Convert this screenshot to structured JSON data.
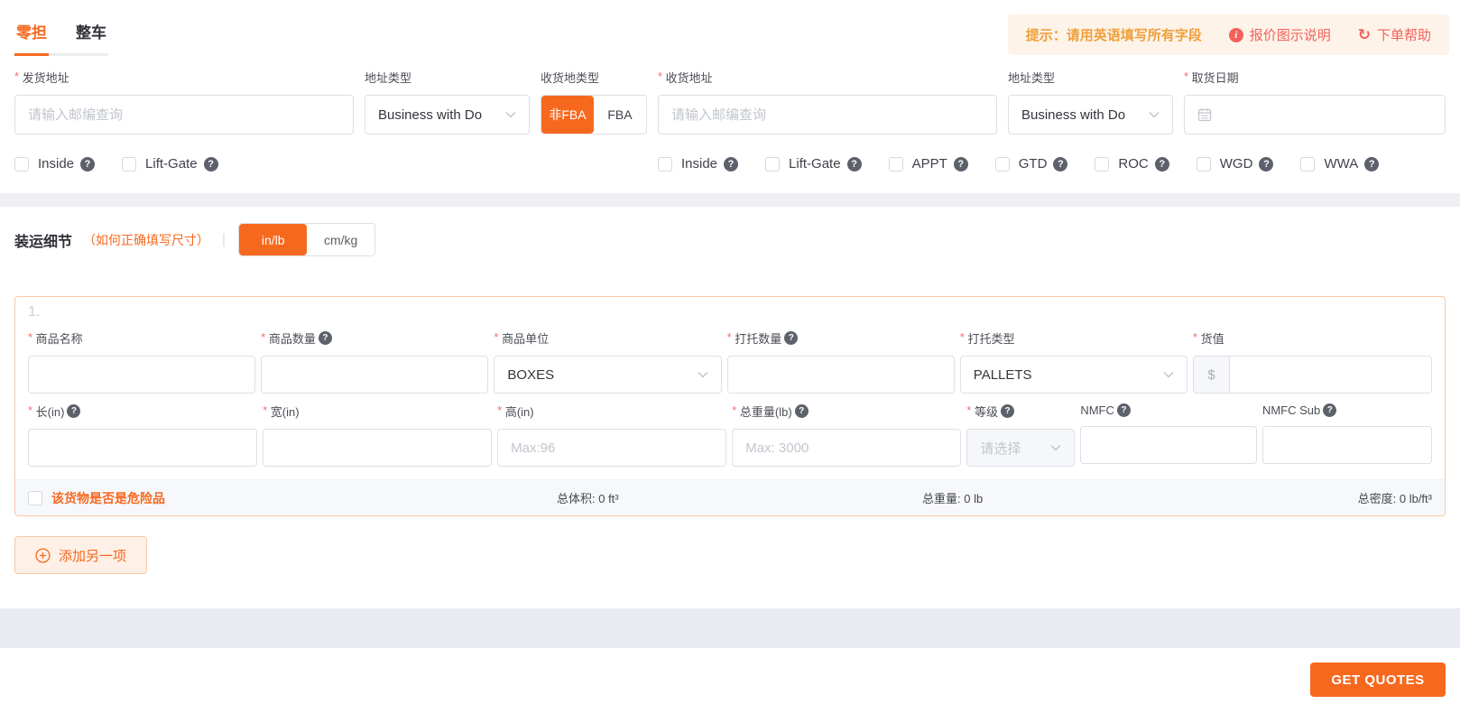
{
  "tabs": [
    {
      "label": "零担",
      "active": true
    },
    {
      "label": "整车",
      "active": false
    }
  ],
  "hint_bar": {
    "tip": "提示：请用英语填写所有字段",
    "quote_guide": "报价图示说明",
    "order_help": "下单帮助"
  },
  "route_form": {
    "pickup_address": {
      "label": "发货地址",
      "placeholder": "请输入邮编查询",
      "value": ""
    },
    "pickup_address_type": {
      "label": "地址类型",
      "value": "Business with Do"
    },
    "dest_type": {
      "label": "收货地类型",
      "options": [
        "非FBA",
        "FBA"
      ],
      "selected": "非FBA"
    },
    "delivery_address": {
      "label": "收货地址",
      "placeholder": "请输入邮编查询",
      "value": ""
    },
    "delivery_address_type": {
      "label": "地址类型",
      "value": "Business with Do"
    },
    "pickup_date": {
      "label": "取货日期",
      "value": ""
    },
    "pickup_options": [
      {
        "label": "Inside",
        "checked": false
      },
      {
        "label": "Lift-Gate",
        "checked": false
      }
    ],
    "delivery_options": [
      {
        "label": "Inside",
        "checked": false
      },
      {
        "label": "Lift-Gate",
        "checked": false
      },
      {
        "label": "APPT",
        "checked": false
      },
      {
        "label": "GTD",
        "checked": false
      },
      {
        "label": "ROC",
        "checked": false
      },
      {
        "label": "WGD",
        "checked": false
      },
      {
        "label": "WWA",
        "checked": false
      }
    ]
  },
  "shipment": {
    "title": "装运细节",
    "subtitle": "（如何正确填写尺寸）",
    "unit_options": [
      "in/lb",
      "cm/kg"
    ],
    "unit_selected": "in/lb",
    "item": {
      "index": "1.",
      "name": {
        "label": "商品名称",
        "value": ""
      },
      "quantity": {
        "label": "商品数量",
        "value": ""
      },
      "unit": {
        "label": "商品单位",
        "value": "BOXES"
      },
      "pallet_count": {
        "label": "打托数量",
        "value": ""
      },
      "pallet_type": {
        "label": "打托类型",
        "value": "PALLETS"
      },
      "cargo_value": {
        "label": "货值",
        "prefix": "$",
        "value": ""
      },
      "length": {
        "label": "长(in)",
        "value": ""
      },
      "width": {
        "label": "宽(in)",
        "value": ""
      },
      "height": {
        "label": "高(in)",
        "placeholder": "Max:96",
        "value": ""
      },
      "weight": {
        "label": "总重量(lb)",
        "placeholder": "Max: 3000",
        "value": ""
      },
      "freight_class": {
        "label": "等级",
        "placeholder": "请选择",
        "value": ""
      },
      "nmfc": {
        "label": "NMFC",
        "value": ""
      },
      "nmfc_sub": {
        "label": "NMFC Sub",
        "value": ""
      },
      "hazmat_label": "该货物是否是危险品",
      "hazmat_checked": false,
      "total_volume": "总体积: 0 ft³",
      "total_weight": "总重量: 0 lb",
      "total_density": "总密度: 0 lb/ft³"
    },
    "add_item_label": "添加另一项"
  },
  "footer": {
    "get_quotes_label": "GET QUOTES"
  },
  "colors": {
    "primary": "#F7681F",
    "danger": "#F2615C",
    "hint_amber": "#EFA03C",
    "card_border": "#F9C8A4"
  }
}
